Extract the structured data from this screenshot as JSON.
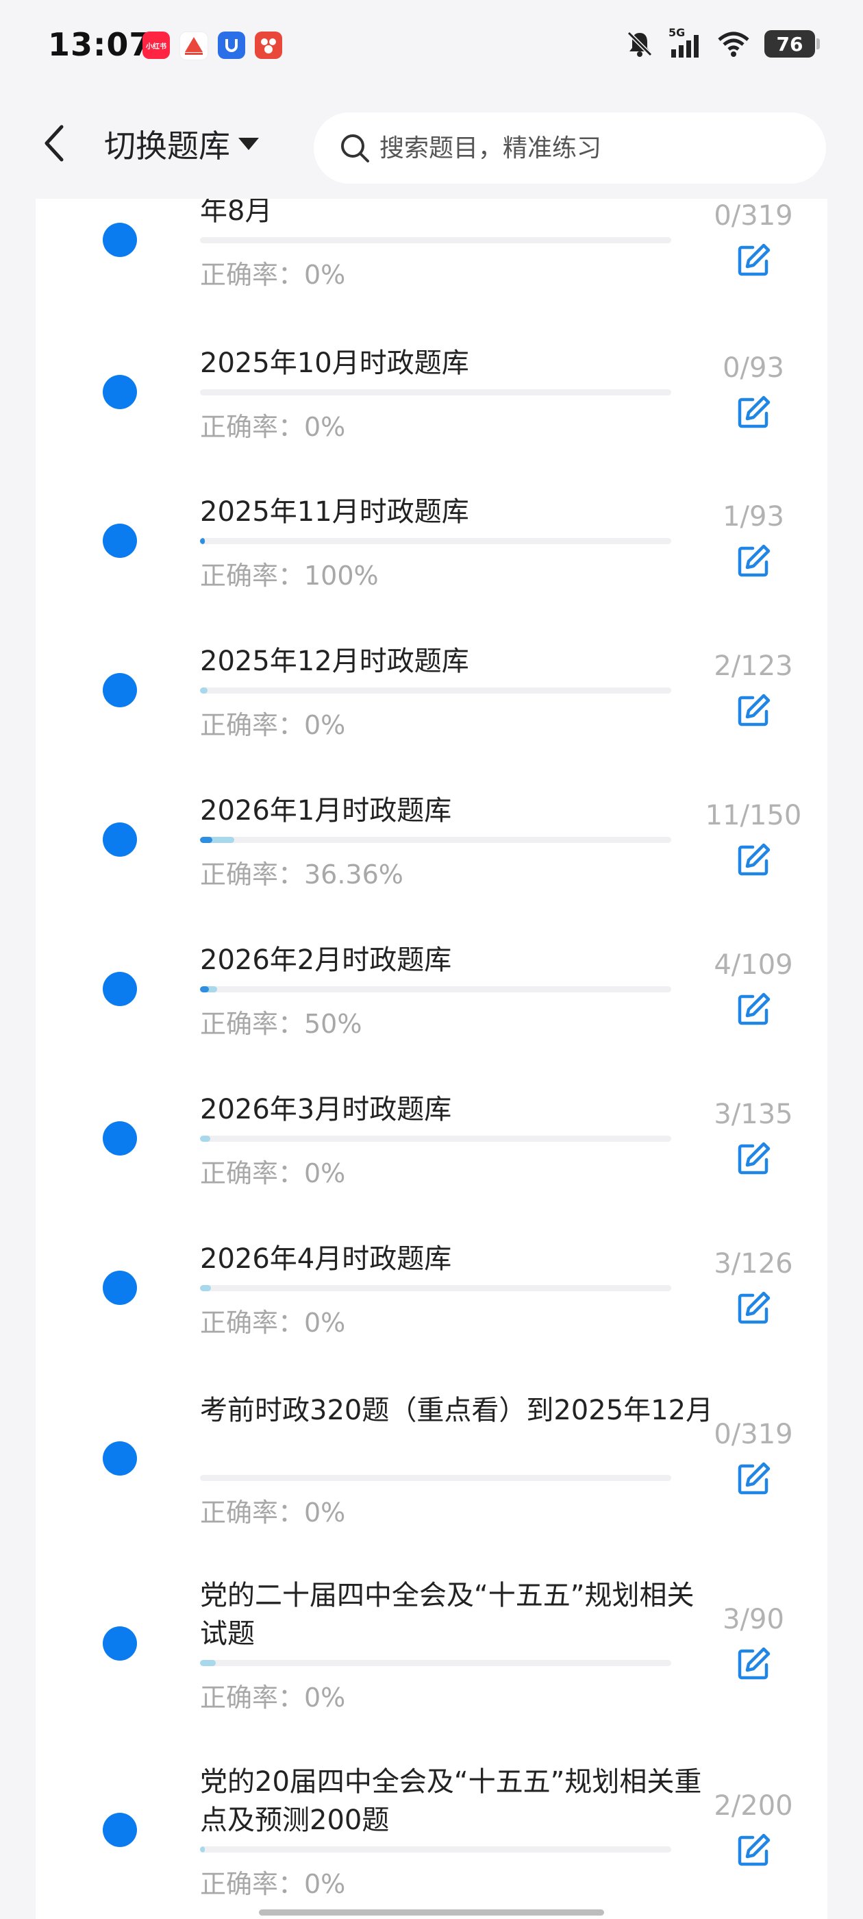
{
  "status_bar": {
    "time": "13:07",
    "apps": [
      {
        "icon": "xiaohongshu-app-icon",
        "label": "小红书",
        "color": "#ff2442"
      },
      {
        "icon": "travel-app-icon",
        "label": "",
        "color": "#ffffff"
      },
      {
        "icon": "blue-app-icon",
        "label": "",
        "color": "#2b6fe8"
      },
      {
        "icon": "red-app-icon",
        "label": "",
        "color": "#e8473a"
      }
    ],
    "network": "5G",
    "battery": "76"
  },
  "header": {
    "back_icon": "chevron-left-icon",
    "switch_label": "切换题库",
    "search_placeholder": "搜索题目，精准练习"
  },
  "colors": {
    "accent": "#0a7cf0",
    "progress_done": "#a8d8ec",
    "progress_correct": "#2e8fe0"
  },
  "items": [
    {
      "title": "年8月",
      "count": "0/319",
      "accuracy": "正确率：0%",
      "done": 0,
      "total": 319,
      "correct_ratio": 0
    },
    {
      "title": "2025年10月时政题库",
      "count": "0/93",
      "accuracy": "正确率：0%",
      "done": 0,
      "total": 93,
      "correct_ratio": 0
    },
    {
      "title": "2025年11月时政题库",
      "count": "1/93",
      "accuracy": "正确率：100%",
      "done": 1,
      "total": 93,
      "correct_ratio": 1
    },
    {
      "title": "2025年12月时政题库",
      "count": "2/123",
      "accuracy": "正确率：0%",
      "done": 2,
      "total": 123,
      "correct_ratio": 0
    },
    {
      "title": "2026年1月时政题库",
      "count": "11/150",
      "accuracy": "正确率：36.36%",
      "done": 11,
      "total": 150,
      "correct_ratio": 0.3636
    },
    {
      "title": "2026年2月时政题库",
      "count": "4/109",
      "accuracy": "正确率：50%",
      "done": 4,
      "total": 109,
      "correct_ratio": 0.5
    },
    {
      "title": "2026年3月时政题库",
      "count": "3/135",
      "accuracy": "正确率：0%",
      "done": 3,
      "total": 135,
      "correct_ratio": 0
    },
    {
      "title": "2026年4月时政题库",
      "count": "3/126",
      "accuracy": "正确率：0%",
      "done": 3,
      "total": 126,
      "correct_ratio": 0
    },
    {
      "title": "考前时政320题（重点看）到2025年12月",
      "count": "0/319",
      "accuracy": "正确率：0%",
      "done": 0,
      "total": 319,
      "correct_ratio": 0
    },
    {
      "title": "党的二十届四中全会及“十五五”规划相关试题",
      "count": "3/90",
      "accuracy": "正确率：0%",
      "done": 3,
      "total": 90,
      "correct_ratio": 0
    },
    {
      "title": "党的20届四中全会及“十五五”规划相关重点及预测200题",
      "count": "2/200",
      "accuracy": "正确率：0%",
      "done": 2,
      "total": 200,
      "correct_ratio": 0
    }
  ]
}
